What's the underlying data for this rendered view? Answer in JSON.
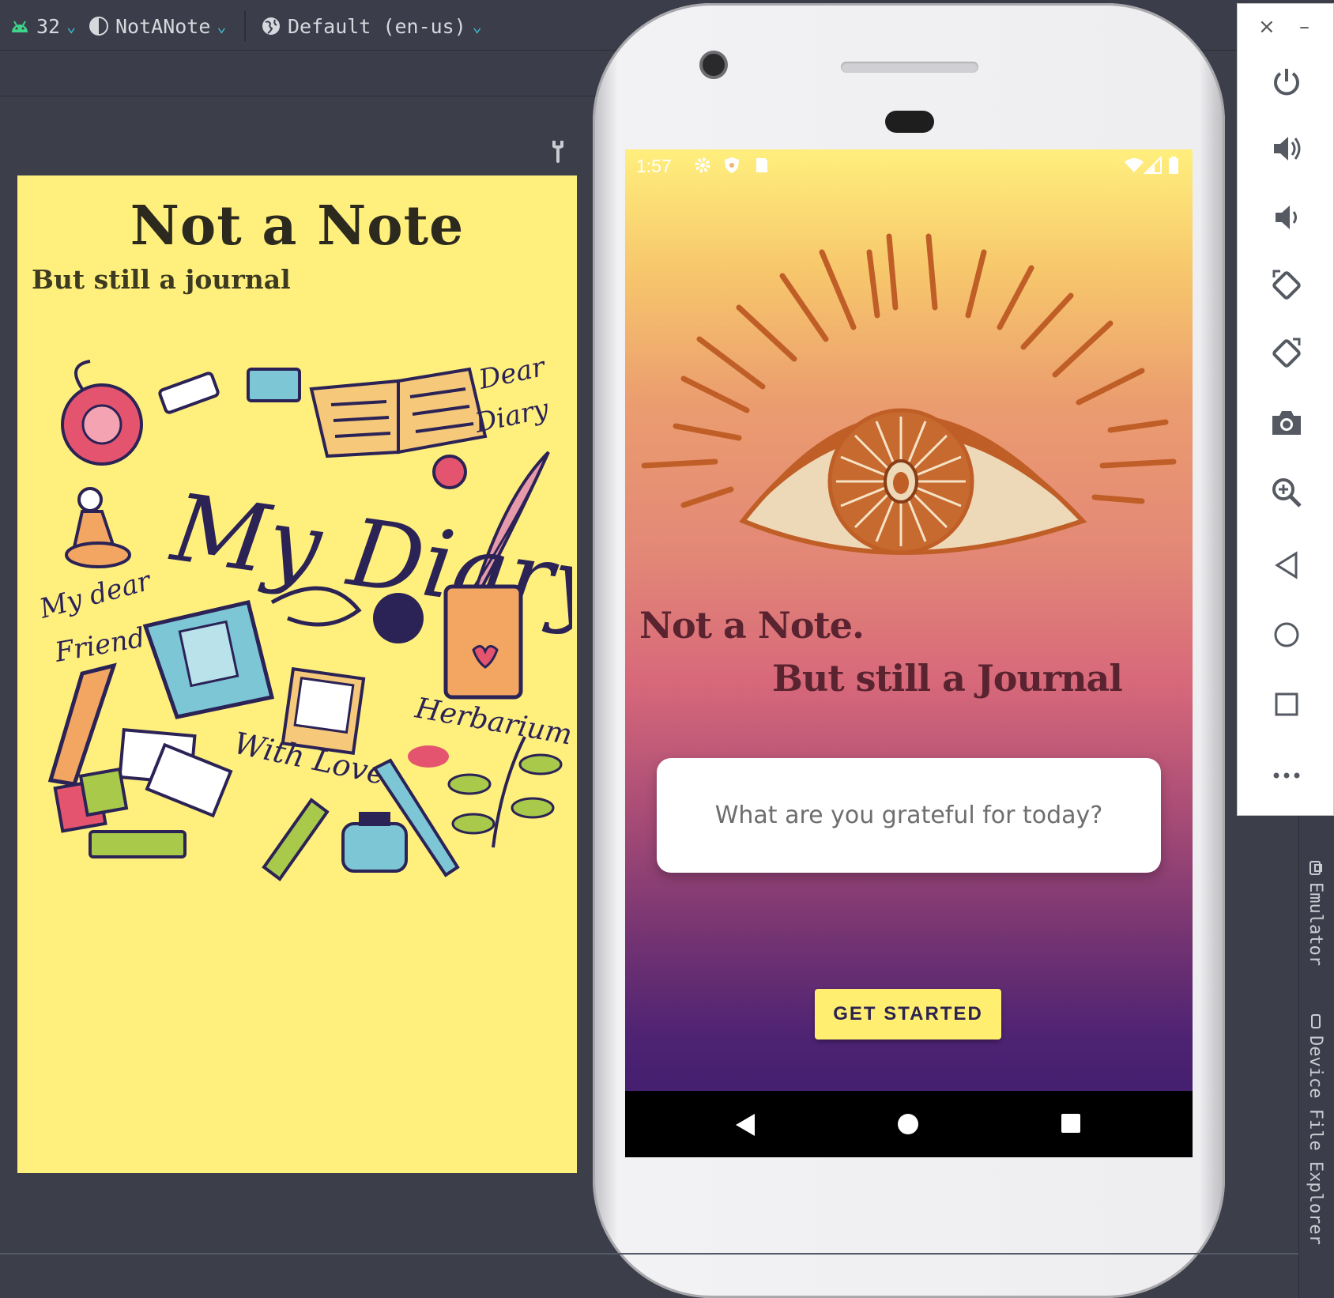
{
  "toolbar": {
    "api_level": "32",
    "theme": "NotANote",
    "locale": "Default (en-us)"
  },
  "preview": {
    "title": "Not a Note",
    "subtitle": "But still a journal",
    "doodle_words": {
      "my_diary": "My Diary",
      "dear_diary_1": "Dear",
      "dear_diary_2": "Diary",
      "my_dear_friend_1": "My dear",
      "my_dear_friend_2": "Friend",
      "herbarium": "Herbarium",
      "with_love": "With Love"
    }
  },
  "device": {
    "status": {
      "time": "1:57"
    },
    "app": {
      "title": "Not a Note.",
      "subtitle": "But still a Journal",
      "input_placeholder": "What are you grateful for today?",
      "button_label": "GET STARTED"
    }
  },
  "emulator": {
    "close_label": "×",
    "minimize_label": "–"
  },
  "tool_windows": {
    "emulator_label": "Emulator",
    "file_explorer_label": "Device File Explorer"
  },
  "colors": {
    "ide_background": "#3c3f4a",
    "accent": "#3fc1d9",
    "preview_background": "#fff07e",
    "button": "#ffee70",
    "title_text": "#5a2330"
  }
}
